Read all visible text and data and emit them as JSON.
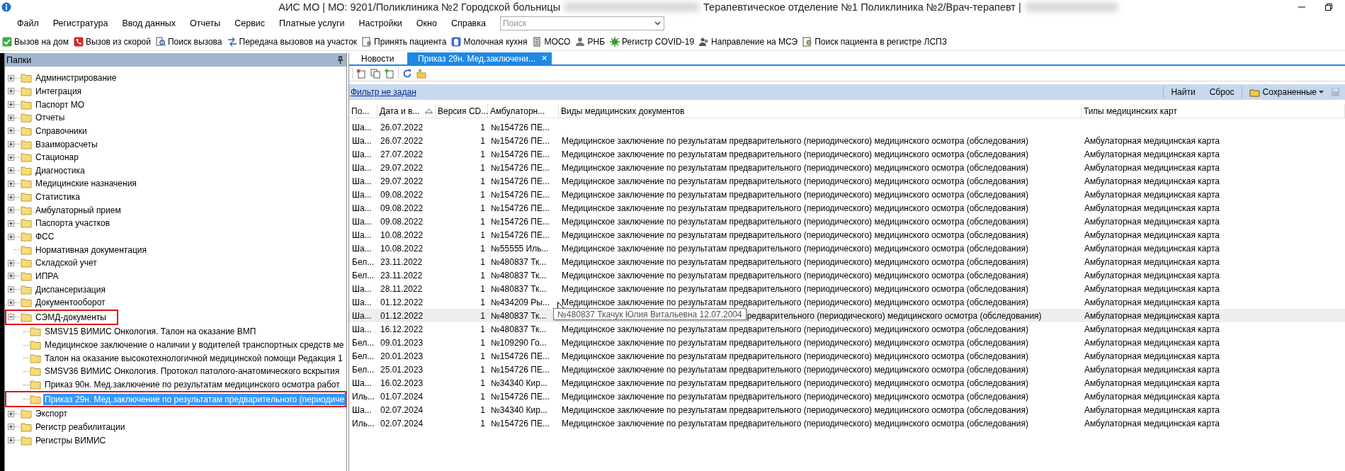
{
  "window": {
    "title_parts": [
      "АИС МО | МО: 9201/Поликлиника №2 Городской больницы",
      "Терапевтическое отделение №1 Поликлиника №2/Врач-терапевт |"
    ]
  },
  "menu": [
    "Файл",
    "Регистратура",
    "Ввод данных",
    "Отчеты",
    "Сервис",
    "Платные услуги",
    "Настройки",
    "Окно",
    "Справка"
  ],
  "search": {
    "placeholder": "Поиск"
  },
  "toolbar": [
    "Вызов на дом",
    "Вызов из скорой",
    "Поиск вызова",
    "Передача вызовов на участок",
    "Принять пациента",
    "Молочная кухня",
    "МОСО",
    "РНБ",
    "Регистр COVID-19",
    "Направление на МСЭ",
    "Поиск пациента в регистре ЛСПЗ"
  ],
  "folders": {
    "title": "Папки",
    "tree": [
      {
        "label": "Администрирование",
        "expanded": false,
        "selected": false
      },
      {
        "label": "Интеграция",
        "expanded": false,
        "selected": false
      },
      {
        "label": "Паспорт МО",
        "expanded": false,
        "selected": false
      },
      {
        "label": "Отчеты",
        "expanded": false,
        "selected": false
      },
      {
        "label": "Справочники",
        "expanded": false,
        "selected": false
      },
      {
        "label": "Взаиморасчеты",
        "expanded": false,
        "selected": false
      },
      {
        "label": "Стационар",
        "expanded": false,
        "selected": false
      },
      {
        "label": "Диагностика",
        "expanded": false,
        "selected": false
      },
      {
        "label": "Медицинские назначения",
        "expanded": false,
        "selected": false
      },
      {
        "label": "Статистика",
        "expanded": false,
        "selected": false
      },
      {
        "label": "Амбулаторный прием",
        "expanded": false,
        "selected": false
      },
      {
        "label": "Паспорта участков",
        "expanded": false,
        "selected": false
      },
      {
        "label": "ФСС",
        "expanded": false,
        "selected": false
      },
      {
        "label": "Нормативная документация",
        "selected": false
      },
      {
        "label": "Складской учет",
        "expanded": false,
        "selected": false
      },
      {
        "label": "ИПРА",
        "expanded": false,
        "selected": false
      },
      {
        "label": "Диспансеризация",
        "expanded": false,
        "selected": false
      },
      {
        "label": "Документооборот",
        "expanded": false,
        "selected": false
      },
      {
        "label": "СЭМД-документы",
        "expanded": true,
        "selected": false,
        "annotated": true,
        "children": [
          {
            "label": "SMSV15 ВИМИС Онкология. Талон на оказание ВМП",
            "selected": false
          },
          {
            "label": "Медицинское заключение о наличии у водителей транспортных средств ме",
            "selected": false
          },
          {
            "label": "Талон на оказание высокотехнологичной медицинской помощи Редакция 1",
            "selected": false
          },
          {
            "label": "SMSV36 ВИМИС Онкология. Протокол патолого-анатомического вскрытия",
            "selected": false
          },
          {
            "label": "Приказ 90н. Мед.заключение по результатам медицинского осмотра работ",
            "selected": false
          },
          {
            "label": "Приказ 29н. Мед.заключение по результатам предварительного (периодиче",
            "selected": true,
            "annotated": true
          }
        ]
      },
      {
        "label": "Экспорт",
        "expanded": false,
        "selected": false
      },
      {
        "label": "Регистр реабилитации",
        "expanded": false,
        "selected": false
      },
      {
        "label": "Регистры ВИМИС",
        "expanded": false,
        "selected": false
      }
    ]
  },
  "tabs": [
    {
      "label": "Новости",
      "selected": false,
      "closable": false
    },
    {
      "label": "Приказ 29н. Мед.заключени...",
      "selected": true,
      "closable": true
    }
  ],
  "close_glyph": "✕",
  "filter": {
    "link": "Фильтр не задан",
    "find": "Найти",
    "reset": "Сброс",
    "saved": "Сохраненные",
    "save_disabled": true
  },
  "table": {
    "columns": [
      {
        "label": "По..."
      },
      {
        "label": "Дата и в...",
        "sorted": true
      },
      {
        "label": "Версия CD..."
      },
      {
        "label": "Амбулаторн..."
      },
      {
        "label": "Виды медицинских документов"
      },
      {
        "label": "Типы медицинских карт"
      }
    ],
    "rows": [
      {
        "author": "Ша...",
        "date": "26.07.2022",
        "version": "1",
        "card": "№154726 ПЕ...",
        "hovered": false
      },
      {
        "author": "Ша...",
        "date": "26.07.2022",
        "version": "1",
        "card": "№154726 ПЕ...",
        "doc_type": "Медицинское заключение по результатам предварительного (периодического) медицинского осмотра (обследования)",
        "card_type": "Амбулаторная медицинская карта",
        "hovered": false
      },
      {
        "author": "Ша...",
        "date": "27.07.2022",
        "version": "1",
        "card": "№154726 ПЕ...",
        "doc_type": "Медицинское заключение по результатам предварительного (периодического) медицинского осмотра (обследования)",
        "card_type": "Амбулаторная медицинская карта",
        "hovered": false
      },
      {
        "author": "Ша...",
        "date": "29.07.2022",
        "version": "1",
        "card": "№154726 ПЕ...",
        "doc_type": "Медицинское заключение по результатам предварительного (периодического) медицинского осмотра (обследования)",
        "card_type": "Амбулаторная медицинская карта",
        "hovered": false
      },
      {
        "author": "Ша...",
        "date": "29.07.2022",
        "version": "1",
        "card": "№154726 ПЕ...",
        "doc_type": "Медицинское заключение по результатам предварительного (периодического) медицинского осмотра (обследования)",
        "card_type": "Амбулаторная медицинская карта",
        "hovered": false
      },
      {
        "author": "Ша...",
        "date": "09.08.2022",
        "version": "1",
        "card": "№154726 ПЕ...",
        "doc_type": "Медицинское заключение по результатам предварительного (периодического) медицинского осмотра (обследования)",
        "card_type": "Амбулаторная медицинская карта",
        "hovered": false
      },
      {
        "author": "Ша...",
        "date": "09.08.2022",
        "version": "1",
        "card": "№154726 ПЕ...",
        "doc_type": "Медицинское заключение по результатам предварительного (периодического) медицинского осмотра (обследования)",
        "card_type": "Амбулаторная медицинская карта",
        "hovered": false
      },
      {
        "author": "Ша...",
        "date": "09.08.2022",
        "version": "1",
        "card": "№154726 ПЕ...",
        "doc_type": "Медицинское заключение по результатам предварительного (периодического) медицинского осмотра (обследования)",
        "card_type": "Амбулаторная медицинская карта",
        "hovered": false
      },
      {
        "author": "Ша...",
        "date": "10.08.2022",
        "version": "1",
        "card": "№154726 ПЕ...",
        "doc_type": "Медицинское заключение по результатам предварительного (периодического) медицинского осмотра (обследования)",
        "card_type": "Амбулаторная медицинская карта",
        "hovered": false
      },
      {
        "author": "Ша...",
        "date": "10.08.2022",
        "version": "1",
        "card": "№55555 Иль...",
        "doc_type": "Медицинское заключение по результатам предварительного (периодического) медицинского осмотра (обследования)",
        "card_type": "Амбулаторная медицинская карта",
        "hovered": false
      },
      {
        "author": "Бел...",
        "date": "23.11.2022",
        "version": "1",
        "card": "№480837 Тк...",
        "doc_type": "Медицинское заключение по результатам предварительного (периодического) медицинского осмотра (обследования)",
        "card_type": "Амбулаторная медицинская карта",
        "hovered": false
      },
      {
        "author": "Бел...",
        "date": "23.11.2022",
        "version": "1",
        "card": "№480837 Тк...",
        "doc_type": "Медицинское заключение по результатам предварительного (периодического) медицинского осмотра (обследования)",
        "card_type": "Амбулаторная медицинская карта",
        "hovered": false
      },
      {
        "author": "Ша...",
        "date": "28.11.2022",
        "version": "1",
        "card": "№480837 Тк...",
        "doc_type": "Медицинское заключение по результатам предварительного (периодического) медицинского осмотра (обследования)",
        "card_type": "Амбулаторная медицинская карта",
        "hovered": false
      },
      {
        "author": "Ша...",
        "date": "01.12.2022",
        "version": "1",
        "card": "№434209 Ры...",
        "doc_type": "Медицинское заключение по результатам предварительного (периодического) медицинского осмотра (обследования)",
        "card_type": "Амбулаторная медицинская карта",
        "hovered": false,
        "pointer": true
      },
      {
        "author": "Ша...",
        "date": "01.12.2022",
        "version": "1",
        "card": "№480837 Тк...",
        "tooltip": "№480837 Ткачук Юлия Витальевна 12.07.2004",
        "doc_type": "редварительного (периодического) медицинского осмотра (обследования)",
        "card_type": "Амбулаторная медицинская карта",
        "hovered": true
      },
      {
        "author": "Ша...",
        "date": "16.12.2022",
        "version": "1",
        "card": "№480837 Тк...",
        "doc_type": "Медицинское заключение по результатам предварительного (периодического) медицинского осмотра (обследования)",
        "card_type": "Амбулаторная медицинская карта",
        "hovered": false
      },
      {
        "author": "Бел...",
        "date": "09.01.2023",
        "version": "1",
        "card": "№109290 Го...",
        "doc_type": "Медицинское заключение по результатам предварительного (периодического) медицинского осмотра (обследования)",
        "card_type": "Амбулаторная медицинская карта",
        "hovered": false
      },
      {
        "author": "Бел...",
        "date": "20.01.2023",
        "version": "1",
        "card": "№154726 ПЕ...",
        "doc_type": "Медицинское заключение по результатам предварительного (периодического) медицинского осмотра (обследования)",
        "card_type": "Амбулаторная медицинская карта",
        "hovered": false
      },
      {
        "author": "Бел...",
        "date": "25.01.2023",
        "version": "1",
        "card": "№154726 ПЕ...",
        "doc_type": "Медицинское заключение по результатам предварительного (периодического) медицинского осмотра (обследования)",
        "card_type": "Амбулаторная медицинская карта",
        "hovered": false
      },
      {
        "author": "Ша...",
        "date": "16.02.2023",
        "version": "1",
        "card": "№34340 Кир...",
        "doc_type": "Медицинское заключение по результатам предварительного (периодического) медицинского осмотра (обследования)",
        "card_type": "Амбулаторная медицинская карта",
        "hovered": false
      },
      {
        "author": "Иль...",
        "date": "01.07.2024",
        "version": "1",
        "card": "№154726 ПЕ...",
        "doc_type": "Медицинское заключение по результатам предварительного (периодического) медицинского осмотра (обследования)",
        "card_type": "Амбулаторная медицинская карта",
        "hovered": false
      },
      {
        "author": "Ша...",
        "date": "02.07.2024",
        "version": "1",
        "card": "№34340 Кир...",
        "doc_type": "Медицинское заключение по результатам предварительного (периодического) медицинского осмотра (обследования)",
        "card_type": "Амбулаторная медицинская карта",
        "hovered": false
      },
      {
        "author": "Иль...",
        "date": "02.07.2024",
        "version": "1",
        "card": "№154726 ПЕ...",
        "doc_type": "Медицинское заключение по результатам предварительного (периодического) медицинского осмотра (обследования)",
        "card_type": "Амбулаторная медицинская карта",
        "hovered": false
      }
    ]
  }
}
